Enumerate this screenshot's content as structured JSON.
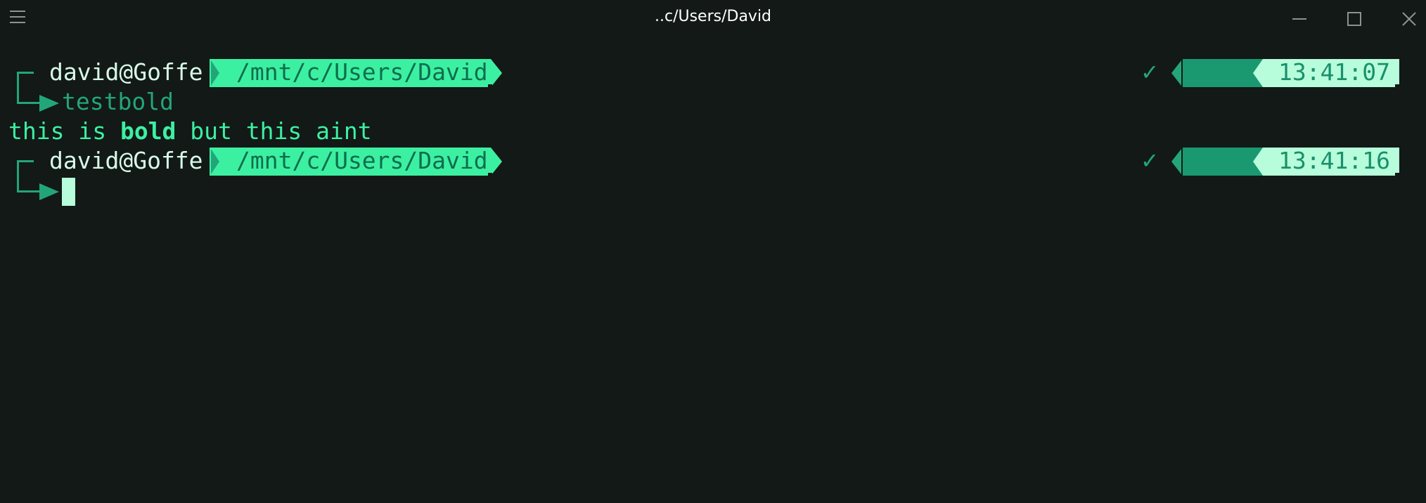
{
  "window": {
    "title": "..c/Users/David",
    "menu_icon": "hamburger-menu-icon",
    "minimize_icon": "minimize-icon",
    "maximize_icon": "maximize-icon",
    "close_icon": "close-icon"
  },
  "colors": {
    "background": "#121917",
    "accent_bright": "#3cf0a2",
    "accent_dark": "#23a57a",
    "accent_darker": "#1a9870",
    "text_light": "#d8fae9",
    "cursor": "#b7fcdb"
  },
  "terminal": {
    "prompts": [
      {
        "user": "david@Goffe",
        "path": "/mnt/c/Users/David",
        "status_icon": "checkmark-icon",
        "status_symbol": "✓",
        "time": "13:41:07",
        "command": "testbold"
      },
      {
        "user": "david@Goffe",
        "path": "/mnt/c/Users/David",
        "status_icon": "checkmark-icon",
        "status_symbol": "✓",
        "time": "13:41:16",
        "command": ""
      }
    ],
    "output": {
      "part1": "this is ",
      "bold": "bold",
      "part2": " but this aint"
    }
  }
}
